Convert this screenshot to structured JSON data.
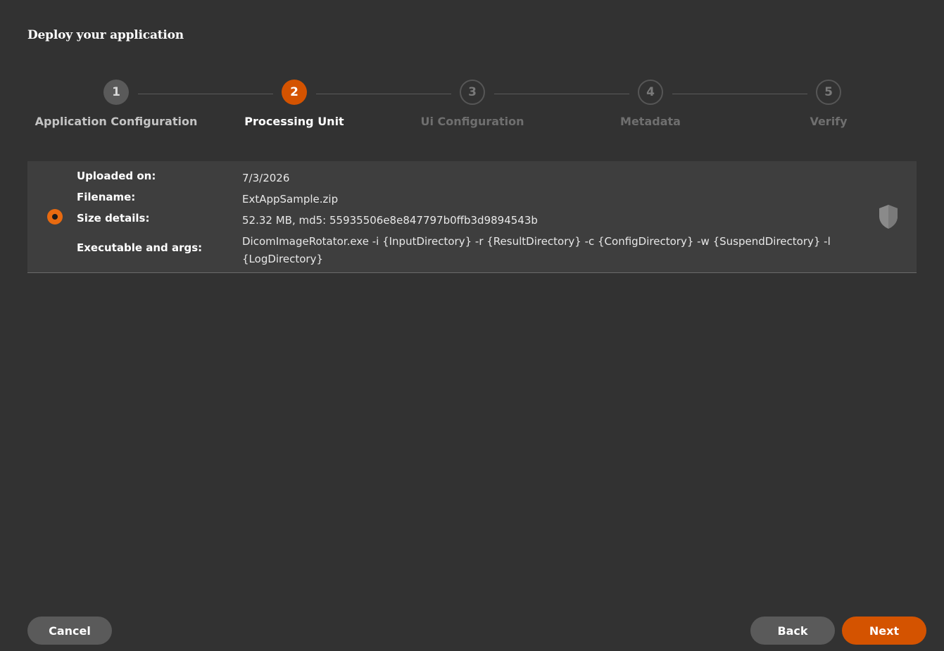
{
  "page": {
    "title": "Deploy your application"
  },
  "stepper": {
    "steps": [
      {
        "number": "1",
        "label": "Application Configuration",
        "state": "done"
      },
      {
        "number": "2",
        "label": "Processing Unit",
        "state": "active"
      },
      {
        "number": "3",
        "label": "Ui Configuration",
        "state": "pending"
      },
      {
        "number": "4",
        "label": "Metadata",
        "state": "pending"
      },
      {
        "number": "5",
        "label": "Verify",
        "state": "pending"
      }
    ]
  },
  "package": {
    "selected": true,
    "rows": [
      {
        "key": "Uploaded on:",
        "value": "7/3/2026"
      },
      {
        "key": "Filename:",
        "value": "ExtAppSample.zip"
      },
      {
        "key": "Size details:",
        "value": "52.32 MB, md5: 55935506e8e847797b0ffb3d9894543b"
      },
      {
        "key": "Executable and args:",
        "value": "DicomImageRotator.exe -i {InputDirectory} -r {ResultDirectory} -c {ConfigDirectory} -w {SuspendDirectory} -l {LogDirectory}"
      }
    ],
    "status_icon": "shield-icon"
  },
  "footer": {
    "cancel_label": "Cancel",
    "back_label": "Back",
    "next_label": "Next"
  },
  "colors": {
    "background": "#323232",
    "card": "#3e3e3e",
    "accent": "#d45300",
    "radio": "#e86a10",
    "button_secondary": "#5a5a5a"
  }
}
